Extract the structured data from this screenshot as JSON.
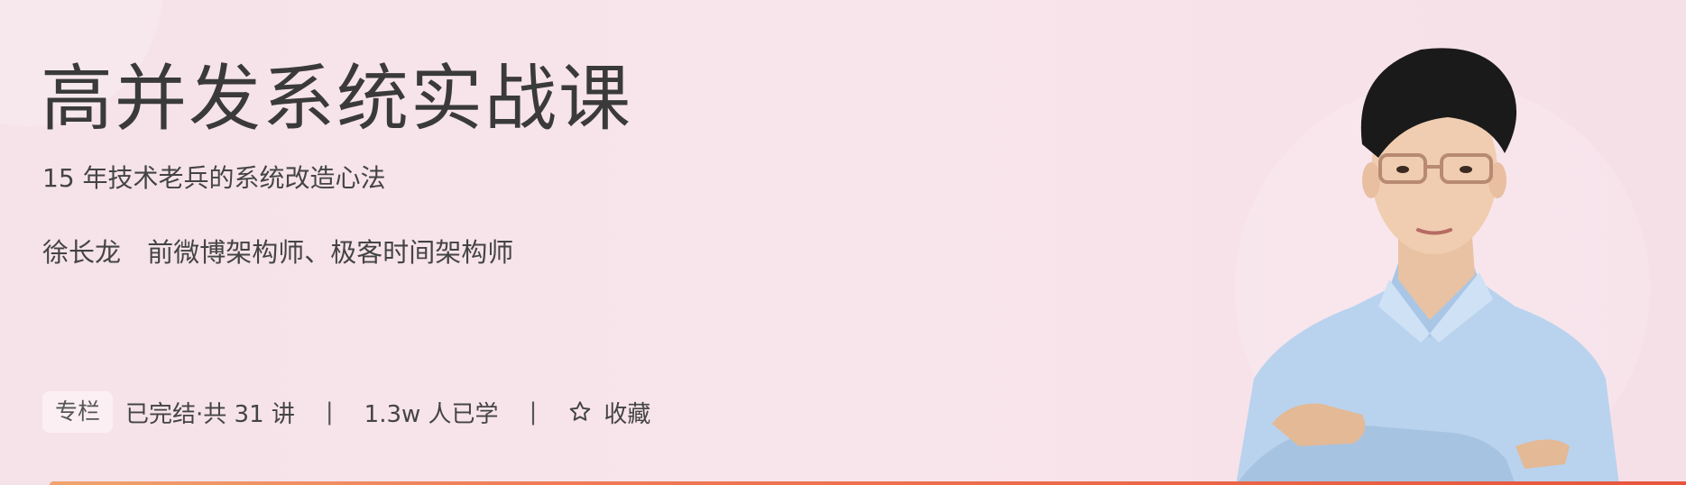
{
  "course": {
    "title": "高并发系统实战课",
    "subtitle": "15 年技术老兵的系统改造心法",
    "author_name": "徐长龙",
    "author_title": "前微博架构师、极客时间架构师"
  },
  "meta": {
    "tag": "专栏",
    "status": "已完结·共 31 讲",
    "separator": "|",
    "learners": "1.3w 人已学",
    "favorite_label": "收藏"
  },
  "icons": {
    "favorite": "star-outline-icon"
  },
  "colors": {
    "background": "#f7e3ea",
    "title": "#3a3a3a",
    "bottom_bar_start": "#f0a36d",
    "bottom_bar_end": "#e8553c"
  }
}
